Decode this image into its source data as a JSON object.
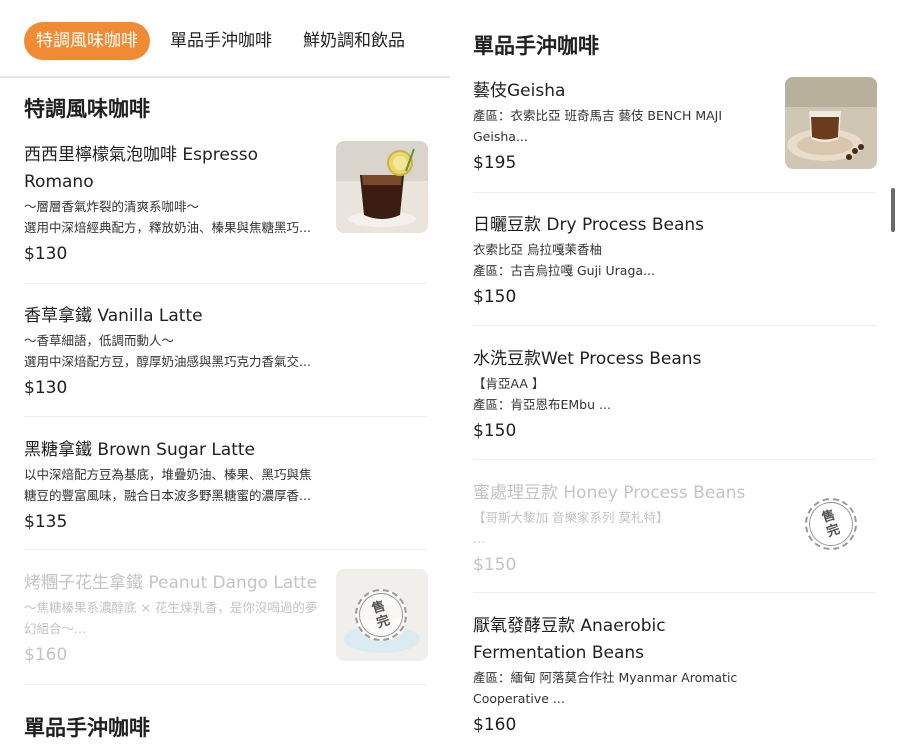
{
  "tabs": [
    {
      "label": "特調風味咖啡",
      "active": true
    },
    {
      "label": "單品手沖咖啡",
      "active": false
    },
    {
      "label": "鮮奶調和飲品",
      "active": false
    }
  ],
  "sections": {
    "specialty": "特調風味咖啡",
    "pourover_left": "單品手沖咖啡",
    "pourover_right": "單品手沖咖啡"
  },
  "left_items": [
    {
      "name_line1": "西西里檸檬氣泡咖啡 Espresso",
      "name_line2": "Romano",
      "desc1": "～層層香氣炸裂的清爽系咖啡～",
      "desc2": "選用中深焙經典配方，釋放奶油、榛果與焦糖黑巧...",
      "price": "$130"
    },
    {
      "name": "香草拿鐵 Vanilla Latte",
      "desc1": "～香草細語，低調而動人～",
      "desc2": "選用中深焙配方豆，醇厚奶油感與黑巧克力香氣交...",
      "price": "$130"
    },
    {
      "name": "黑糖拿鐵 Brown Sugar Latte",
      "desc1": "以中深焙配方豆為基底，堆疊奶油、榛果、黑巧與焦",
      "desc2": "糖豆的豐富風味，融合日本波多野黑糖蜜的濃厚香...",
      "price": "$135"
    },
    {
      "name": "烤糰子花生拿鐵 Peanut Dango Latte",
      "desc1": "～焦糖榛果系濃醇底 × 花生煉乳香，是你沒喝過的夢",
      "desc2": "幻組合～...",
      "price": "$160",
      "sold_out": true
    }
  ],
  "right_items": [
    {
      "name": "藝伎Geisha",
      "desc1": "產區：衣索比亞  班奇馬吉 藝伎 BENCH MAJI",
      "desc2": "Geisha...",
      "price": "$195"
    },
    {
      "name": "日曬豆款 Dry Process Beans",
      "desc1": "衣索比亞  烏拉嘎茉香柚",
      "desc2": "產區：古吉烏拉嘎 Guji Uraga...",
      "price": "$150"
    },
    {
      "name": "水洗豆款Wet Process Beans",
      "desc1": "【肯亞AA 】",
      "desc2": "產區：肯亞恩布EMbu ...",
      "price": "$150"
    },
    {
      "name": "蜜處理豆款 Honey Process Beans",
      "desc1": "【哥斯大黎加 音樂家系列 莫札特】",
      "desc2": "...",
      "price": "$150",
      "sold_out": true
    },
    {
      "name_line1": "厭氧發酵豆款 Anaerobic",
      "name_line2": "Fermentation Beans",
      "desc1": "產區：緬甸 阿落莫合作社  Myanmar Aromatic",
      "desc2": "Cooperative ...",
      "price": "$160"
    }
  ],
  "sold_out_stamp": {
    "char1": "售",
    "char2": "完"
  },
  "colors": {
    "accent": "#f08a33",
    "sold_out_text": "#c4c4c4",
    "divider": "#eeeeee"
  }
}
